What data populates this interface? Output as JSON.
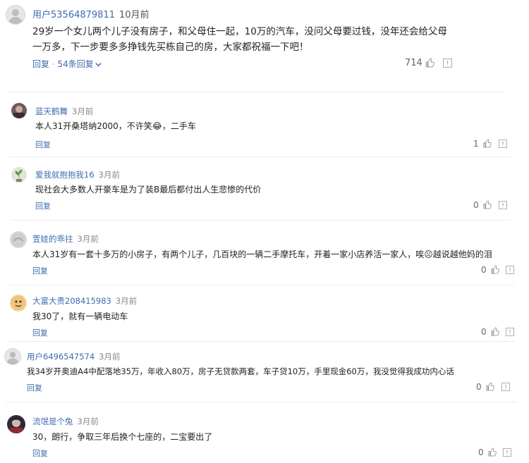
{
  "top_comment": {
    "username": "用户53564879811",
    "time": "10月前",
    "text_line1": "29岁一个女儿两个儿子没有房子，和父母住一起，10万的汽车，没问父母要过钱，没年还会给父母",
    "text_line2": "一万多，下一步要多多挣钱先买栋自己的房，大家都祝福一下吧！",
    "reply_label": "回复",
    "separator": "·",
    "replies_label": "54条回复",
    "like_count": "714"
  },
  "replies": [
    {
      "username": "蓝天鹤舞",
      "time": "3月前",
      "text": "本人31开桑塔纳2000，不许笑😂，二手车",
      "reply_label": "回复",
      "likes": "1"
    },
    {
      "username": "爱我就抱抱我16",
      "time": "3月前",
      "text": "现社会大多数人开豪车是为了装B最后都付出人生悲惨的代价",
      "reply_label": "回复",
      "likes": "0"
    },
    {
      "username": "萱娃的乖拄",
      "time": "3月前",
      "text": "本人31岁有一套十多万的小房子，有两个儿子，几百块的一辆二手摩托车，开着一家小店养活一家人，唉☹越说越他妈的泪",
      "reply_label": "回复",
      "likes": "0"
    },
    {
      "username": "大富大贵208415983",
      "time": "3月前",
      "text": "我30了，就有一辆电动车",
      "reply_label": "回复",
      "likes": "0"
    },
    {
      "username": "用户6496547574",
      "time": "3月前",
      "text": "我34岁开奥迪A4中配落地35万，年收入80万，房子无贷款两套，车子贷10万，手里现金60万，我没觉得我成功内心话",
      "reply_label": "回复",
      "likes": "0"
    },
    {
      "username": "流氓是个兔",
      "time": "3月前",
      "text": "30，朗行，争取三年后换个七座的，二宝要出了",
      "reply_label": "回复",
      "likes": "0"
    }
  ],
  "icons": {
    "like": "thumbs-up-icon",
    "report": "report-icon",
    "expand": "chevron-down-icon",
    "avatar_default": "default-avatar-icon"
  },
  "colors": {
    "link": "#3f6bb0",
    "muted": "#888888",
    "divider": "#ececec"
  }
}
